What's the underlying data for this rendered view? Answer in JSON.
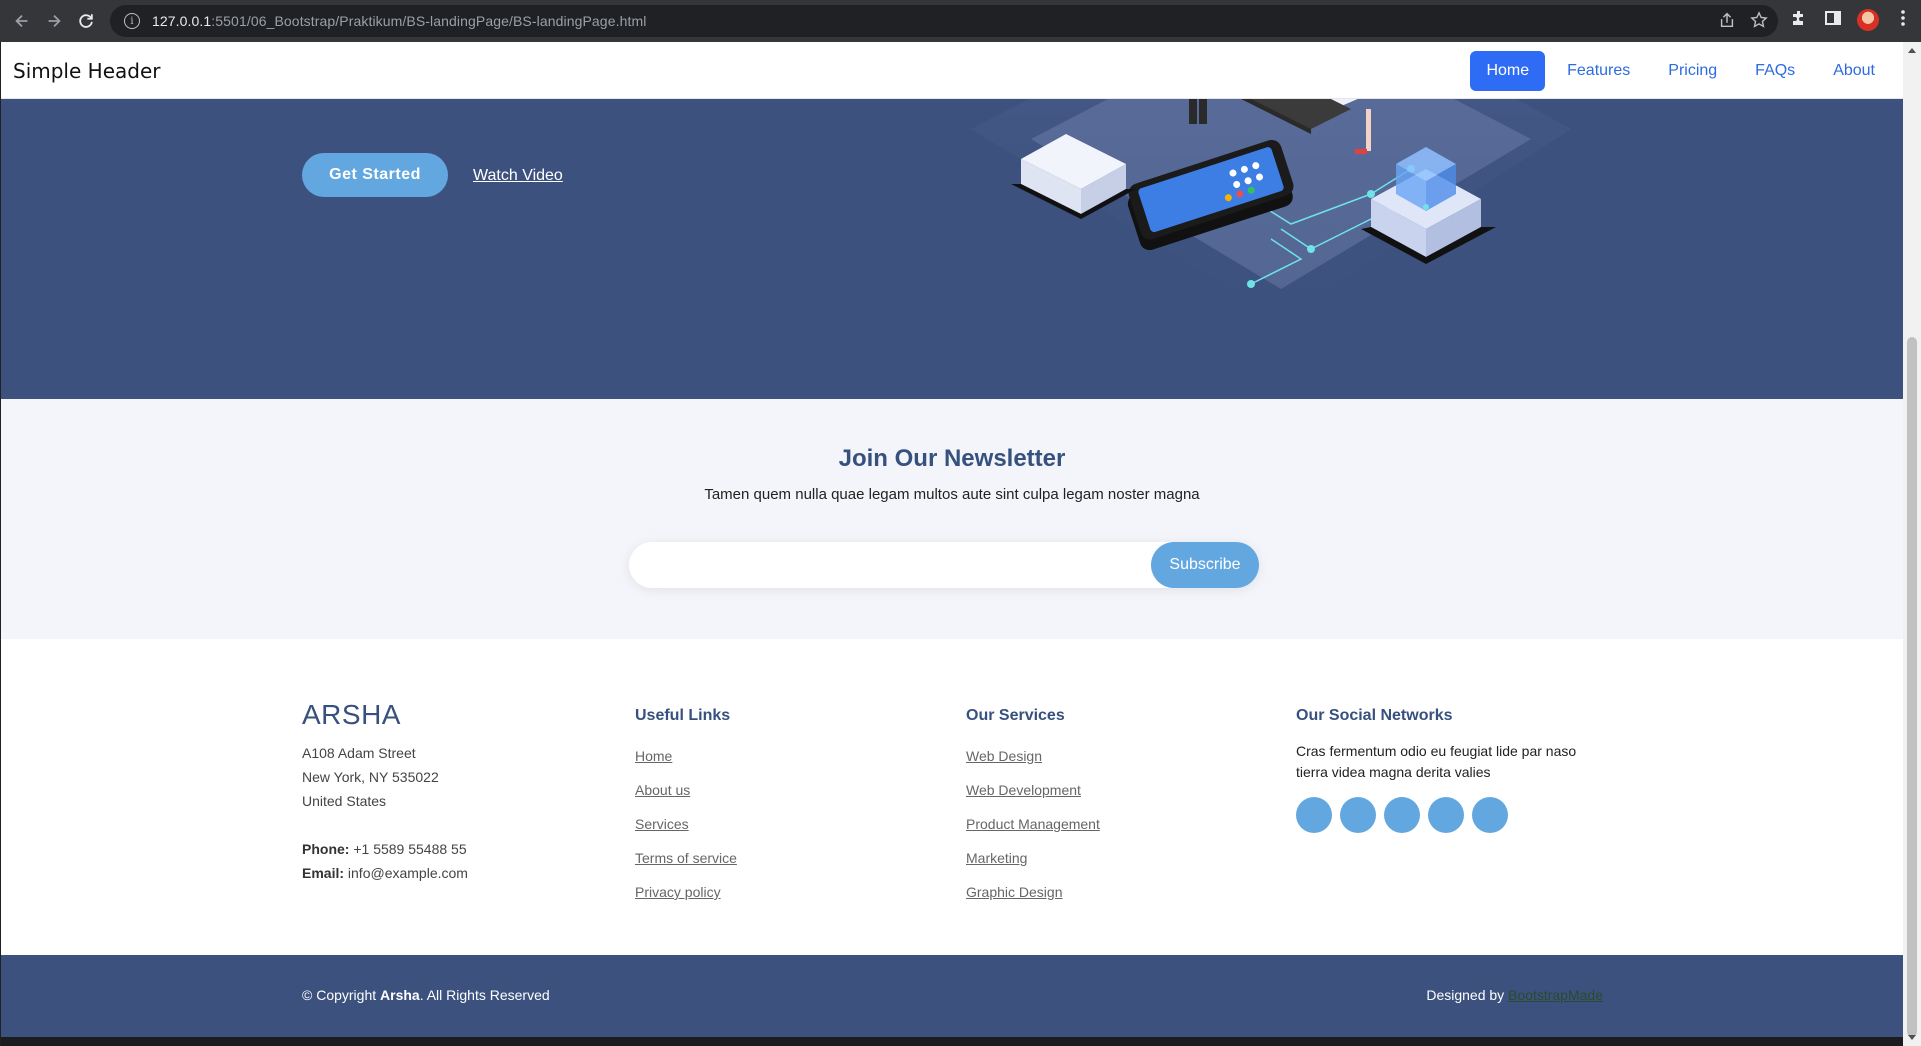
{
  "browser": {
    "url_host": "127.0.0.1",
    "url_path": ":5501/06_Bootstrap/Praktikum/BS-landingPage/BS-landingPage.html"
  },
  "header": {
    "brand": "Simple Header",
    "nav": [
      "Home",
      "Features",
      "Pricing",
      "FAQs",
      "About"
    ],
    "active": "Home"
  },
  "hero": {
    "cta_label": "Get Started",
    "video_label": "Watch Video"
  },
  "newsletter": {
    "title": "Join Our Newsletter",
    "text": "Tamen quem nulla quae legam multos aute sint culpa legam noster magna",
    "input_value": "",
    "button_label": "Subscribe"
  },
  "footer": {
    "brand": "ARSHA",
    "address": [
      "A108 Adam Street",
      "New York, NY 535022",
      "United States"
    ],
    "phone_label": "Phone:",
    "phone": "+1 5589 55488 55",
    "email_label": "Email:",
    "email": "info@example.com",
    "useful_links_title": "Useful Links",
    "useful_links": [
      "Home",
      "About us",
      "Services",
      "Terms of service",
      "Privacy policy"
    ],
    "services_title": "Our Services",
    "services": [
      "Web Design",
      "Web Development",
      "Product Management",
      "Marketing",
      "Graphic Design"
    ],
    "social_title": "Our Social Networks",
    "social_text": "Cras fermentum odio eu feugiat lide par naso tierra videa magna derita valies",
    "social_icons": [
      "twitter-icon",
      "facebook-icon",
      "instagram-icon",
      "skype-icon",
      "linkedin-icon"
    ],
    "copyright_prefix": "© Copyright ",
    "copyright_brand": "Arsha",
    "copyright_suffix": ". All Rights Reserved",
    "designed_by": "Designed by ",
    "designer": "BootstrapMade"
  },
  "colors": {
    "hero_bg": "#3d517f",
    "accent": "#63a7e1",
    "nav_active": "#2f6cf6",
    "heading": "#37517e"
  }
}
